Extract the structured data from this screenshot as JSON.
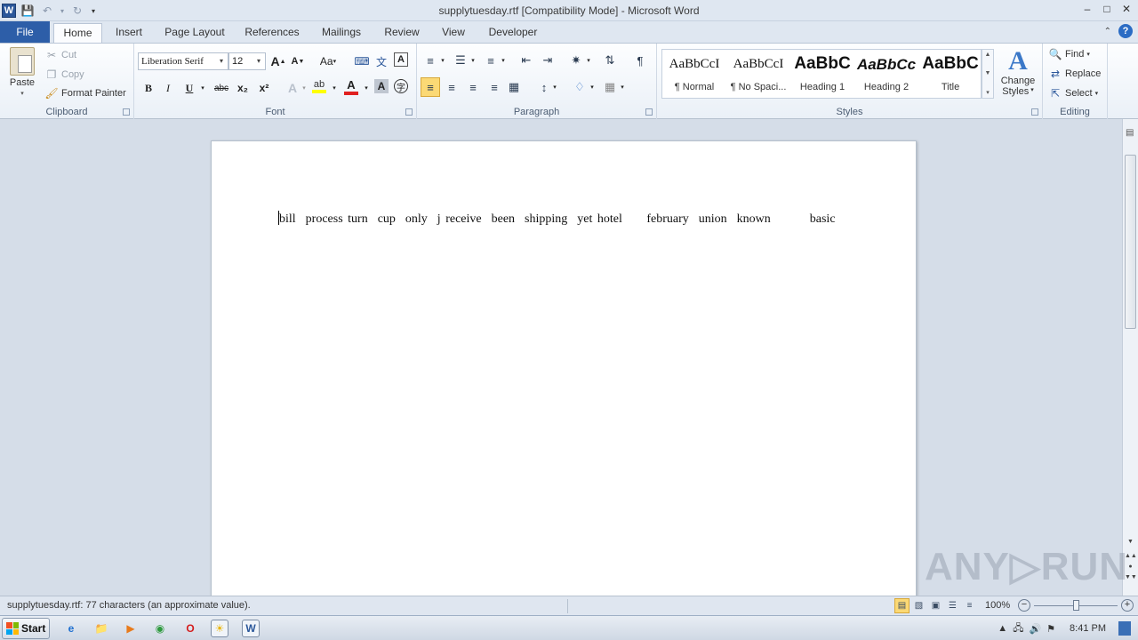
{
  "window": {
    "title": "supplytuesday.rtf [Compatibility Mode]  -  Microsoft Word",
    "logo_letter": "W"
  },
  "tabs": [
    {
      "label": "File"
    },
    {
      "label": "Home"
    },
    {
      "label": "Insert"
    },
    {
      "label": "Page Layout"
    },
    {
      "label": "References"
    },
    {
      "label": "Mailings"
    },
    {
      "label": "Review"
    },
    {
      "label": "View"
    },
    {
      "label": "Developer"
    }
  ],
  "ribbon": {
    "clipboard": {
      "label": "Clipboard",
      "paste": "Paste",
      "cut": "Cut",
      "copy": "Copy",
      "format_painter": "Format Painter"
    },
    "font": {
      "label": "Font",
      "font_name": "Liberation Serif",
      "font_size": "12",
      "grow": "A",
      "shrink": "A",
      "change_case": "Aa",
      "bold": "B",
      "italic": "I",
      "underline": "U",
      "strikethrough": "abc",
      "subscript": "x₂",
      "superscript": "x²",
      "font_color_letter": "A",
      "highlight_color": "#ffff00",
      "font_color": "#e02020"
    },
    "paragraph": {
      "label": "Paragraph"
    },
    "styles": {
      "label": "Styles",
      "items": [
        {
          "sample": "AaBbCcI",
          "name": "¶ Normal"
        },
        {
          "sample": "AaBbCcI",
          "name": "¶ No Spaci..."
        },
        {
          "sample": "AaBbC",
          "name": "Heading 1"
        },
        {
          "sample": "AaBbCc",
          "name": "Heading 2"
        },
        {
          "sample": "AaBbC",
          "name": "Title"
        }
      ],
      "change_styles_1": "Change",
      "change_styles_2": "Styles"
    },
    "editing": {
      "label": "Editing",
      "find": "Find",
      "replace": "Replace",
      "select": "Select"
    }
  },
  "document": {
    "text": "bill  process turn  cup  only  j receive  been  shipping  yet hotel     february  union  known        basic"
  },
  "status": {
    "text": "supplytuesday.rtf: 77 characters (an approximate value).",
    "zoom": "100%",
    "zoom_fraction": 0.5
  },
  "taskbar": {
    "start": "Start",
    "clock": "8:41 PM"
  },
  "watermark": "ANY▷RUN"
}
